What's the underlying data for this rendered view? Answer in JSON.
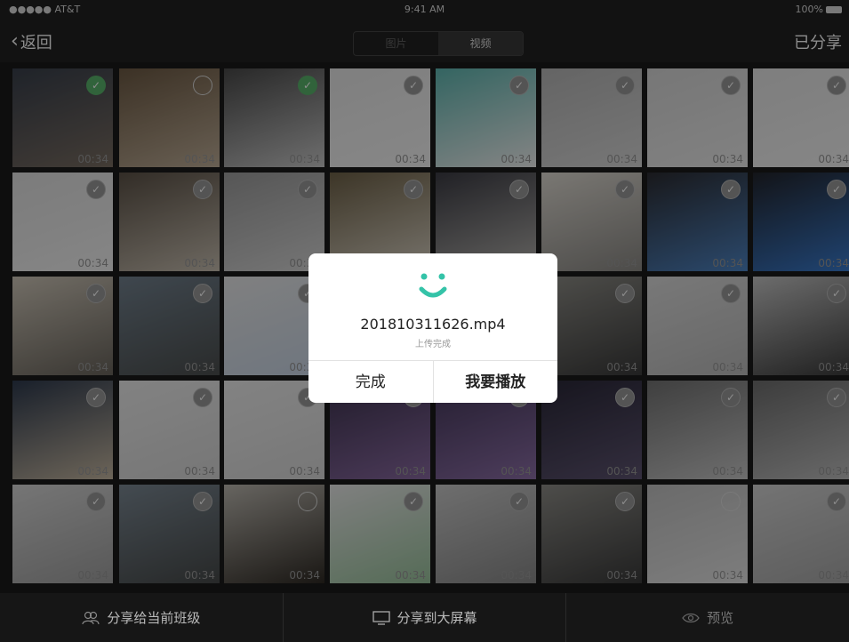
{
  "status_bar": {
    "carrier": "●●●●● AT&T",
    "time": "9:41 AM",
    "battery": "100%"
  },
  "nav": {
    "back_label": "返回",
    "tabs": [
      "图片",
      "视频"
    ],
    "active_tab": 1,
    "shared_label": "已分享"
  },
  "tiles": [
    {
      "time": "00:34",
      "check": "filled",
      "c1": "#39404c",
      "c2": "#7a6e63"
    },
    {
      "time": "00:34",
      "check": "empty",
      "c1": "#6d5a44",
      "c2": "#bfae98"
    },
    {
      "time": "00:34",
      "check": "filled",
      "c1": "#4a4a4a",
      "c2": "#c9c9c9"
    },
    {
      "time": "00:34",
      "check": "grey",
      "c1": "#e8e8e8",
      "c2": "#f6f6f6"
    },
    {
      "time": "00:34",
      "check": "grey",
      "c1": "#5fb8b2",
      "c2": "#f1f1f1"
    },
    {
      "time": "00:34",
      "check": "grey",
      "c1": "#b7b7b7",
      "c2": "#d8d8d8"
    },
    {
      "time": "00:34",
      "check": "grey",
      "c1": "#d8d8d8",
      "c2": "#ececec"
    },
    {
      "time": "00:34",
      "check": "grey",
      "c1": "#e6e6e6",
      "c2": "#f4f4f4"
    },
    {
      "time": "00:34",
      "check": "grey",
      "c1": "#e1e1e1",
      "c2": "#f3f3f3"
    },
    {
      "time": "00:34",
      "check": "grey",
      "c1": "#5c5247",
      "c2": "#c8bfb1"
    },
    {
      "time": "00:34",
      "check": "grey",
      "c1": "#9d9d9d",
      "c2": "#d6d6d6"
    },
    {
      "time": "00:34",
      "check": "grey",
      "c1": "#6f6248",
      "c2": "#d9d2c4"
    },
    {
      "time": "00:34",
      "check": "grey",
      "c1": "#3c3c44",
      "c2": "#b3b1ad"
    },
    {
      "time": "00:34",
      "check": "grey",
      "c1": "#dedad2",
      "c2": "#8c8a86"
    },
    {
      "time": "00:34",
      "check": "grey",
      "c1": "#2d2d32",
      "c2": "#4f86c6"
    },
    {
      "time": "00:34",
      "check": "grey",
      "c1": "#23252c",
      "c2": "#3a7cd0"
    },
    {
      "time": "00:34",
      "check": "grey",
      "c1": "#cfc7b9",
      "c2": "#6a655d"
    },
    {
      "time": "00:34",
      "check": "grey",
      "c1": "#73828f",
      "c2": "#4c4f4f"
    },
    {
      "time": "00:34",
      "check": "grey",
      "c1": "#e9e9e9",
      "c2": "#c9d6e7"
    },
    {
      "time": "00:34",
      "check": "grey",
      "c1": "#cfcfcf",
      "c2": "#f1f1f1"
    },
    {
      "time": "00:34",
      "check": "grey",
      "c1": "#bdbdbd",
      "c2": "#dcdcdc"
    },
    {
      "time": "00:34",
      "check": "grey",
      "c1": "#8f8e88",
      "c2": "#3b3b3b"
    },
    {
      "time": "00:34",
      "check": "grey",
      "c1": "#dcdcdc",
      "c2": "#bcbcbc"
    },
    {
      "time": "00:34",
      "check": "grey",
      "c1": "#c6c6c6",
      "c2": "#3a3a3a"
    },
    {
      "time": "00:34",
      "check": "grey",
      "c1": "#2e3a4e",
      "c2": "#c6b8a2"
    },
    {
      "time": "00:34",
      "check": "grey",
      "c1": "#ededed",
      "c2": "#d8d8d8"
    },
    {
      "time": "00:34",
      "check": "grey",
      "c1": "#eeeeee",
      "c2": "#dadada"
    },
    {
      "time": "00:34",
      "check": "grey",
      "c1": "#3e3450",
      "c2": "#8a6aa2"
    },
    {
      "time": "00:34",
      "check": "grey",
      "c1": "#44385a",
      "c2": "#8d6fa8"
    },
    {
      "time": "00:34",
      "check": "grey",
      "c1": "#2a2838",
      "c2": "#5e5472"
    },
    {
      "time": "00:34",
      "check": "grey",
      "c1": "#747474",
      "c2": "#c8c8c8"
    },
    {
      "time": "00:34",
      "check": "grey",
      "c1": "#6f6f6f",
      "c2": "#bfbfbf"
    },
    {
      "time": "00:34",
      "check": "grey",
      "c1": "#d6d6d6",
      "c2": "#a1a1a1"
    },
    {
      "time": "00:34",
      "check": "grey",
      "c1": "#7c8994",
      "c2": "#474a4a"
    },
    {
      "time": "00:34",
      "check": "empty",
      "c1": "#bcb8b0",
      "c2": "#2f2a24"
    },
    {
      "time": "00:34",
      "check": "grey",
      "c1": "#e9e9e9",
      "c2": "#9bc49e"
    },
    {
      "time": "00:34",
      "check": "grey",
      "c1": "#c9c9c9",
      "c2": "#8a8a8a"
    },
    {
      "time": "00:34",
      "check": "grey",
      "c1": "#8e8d88",
      "c2": "#3b3b3b"
    },
    {
      "time": "00:34",
      "check": "empty",
      "c1": "#c2c2c2",
      "c2": "#e4e4e4"
    },
    {
      "time": "00:34",
      "check": "grey",
      "c1": "#d3d3d3",
      "c2": "#a8a8a8"
    }
  ],
  "dialog": {
    "filename": "201810311626.mp4",
    "subtitle": "上传完成",
    "done_label": "完成",
    "play_label": "我要播放"
  },
  "bottom_bar": {
    "share_class": "分享给当前班级",
    "share_screen": "分享到大屏幕",
    "preview": "预览"
  },
  "colors": {
    "accent": "#5ab46c",
    "smile": "#34c3a8"
  }
}
